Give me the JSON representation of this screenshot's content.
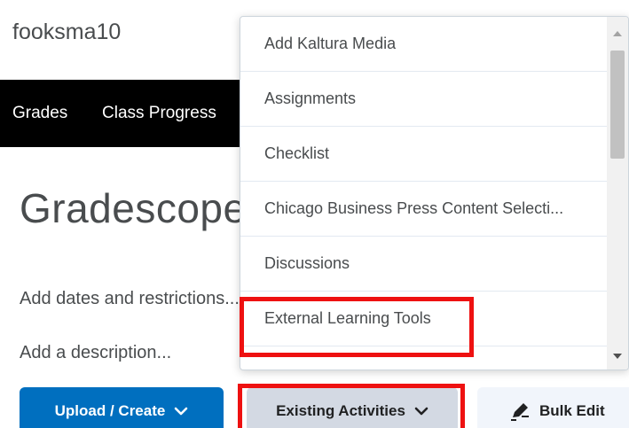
{
  "course": {
    "name": "fooksma10"
  },
  "nav": {
    "items": [
      "Grades",
      "Class Progress"
    ]
  },
  "page": {
    "title": "Gradescope",
    "add_dates_label": "Add dates and restrictions...",
    "add_description_label": "Add a description..."
  },
  "toolbar": {
    "upload_create_label": "Upload / Create",
    "existing_activities_label": "Existing Activities",
    "bulk_edit_label": "Bulk Edit"
  },
  "dropdown": {
    "items": [
      "Add Kaltura Media",
      "Assignments",
      "Checklist",
      "Chicago Business Press Content Selecti...",
      "Discussions",
      "External Learning Tools",
      ""
    ]
  },
  "colors": {
    "primary": "#006fbf",
    "navbar": "#000000",
    "highlight": "#ee1111",
    "secondary_button": "#d3d9e3"
  },
  "icons": {
    "chevron": "chevron-down-icon",
    "bulk_edit": "pencil-icon"
  }
}
